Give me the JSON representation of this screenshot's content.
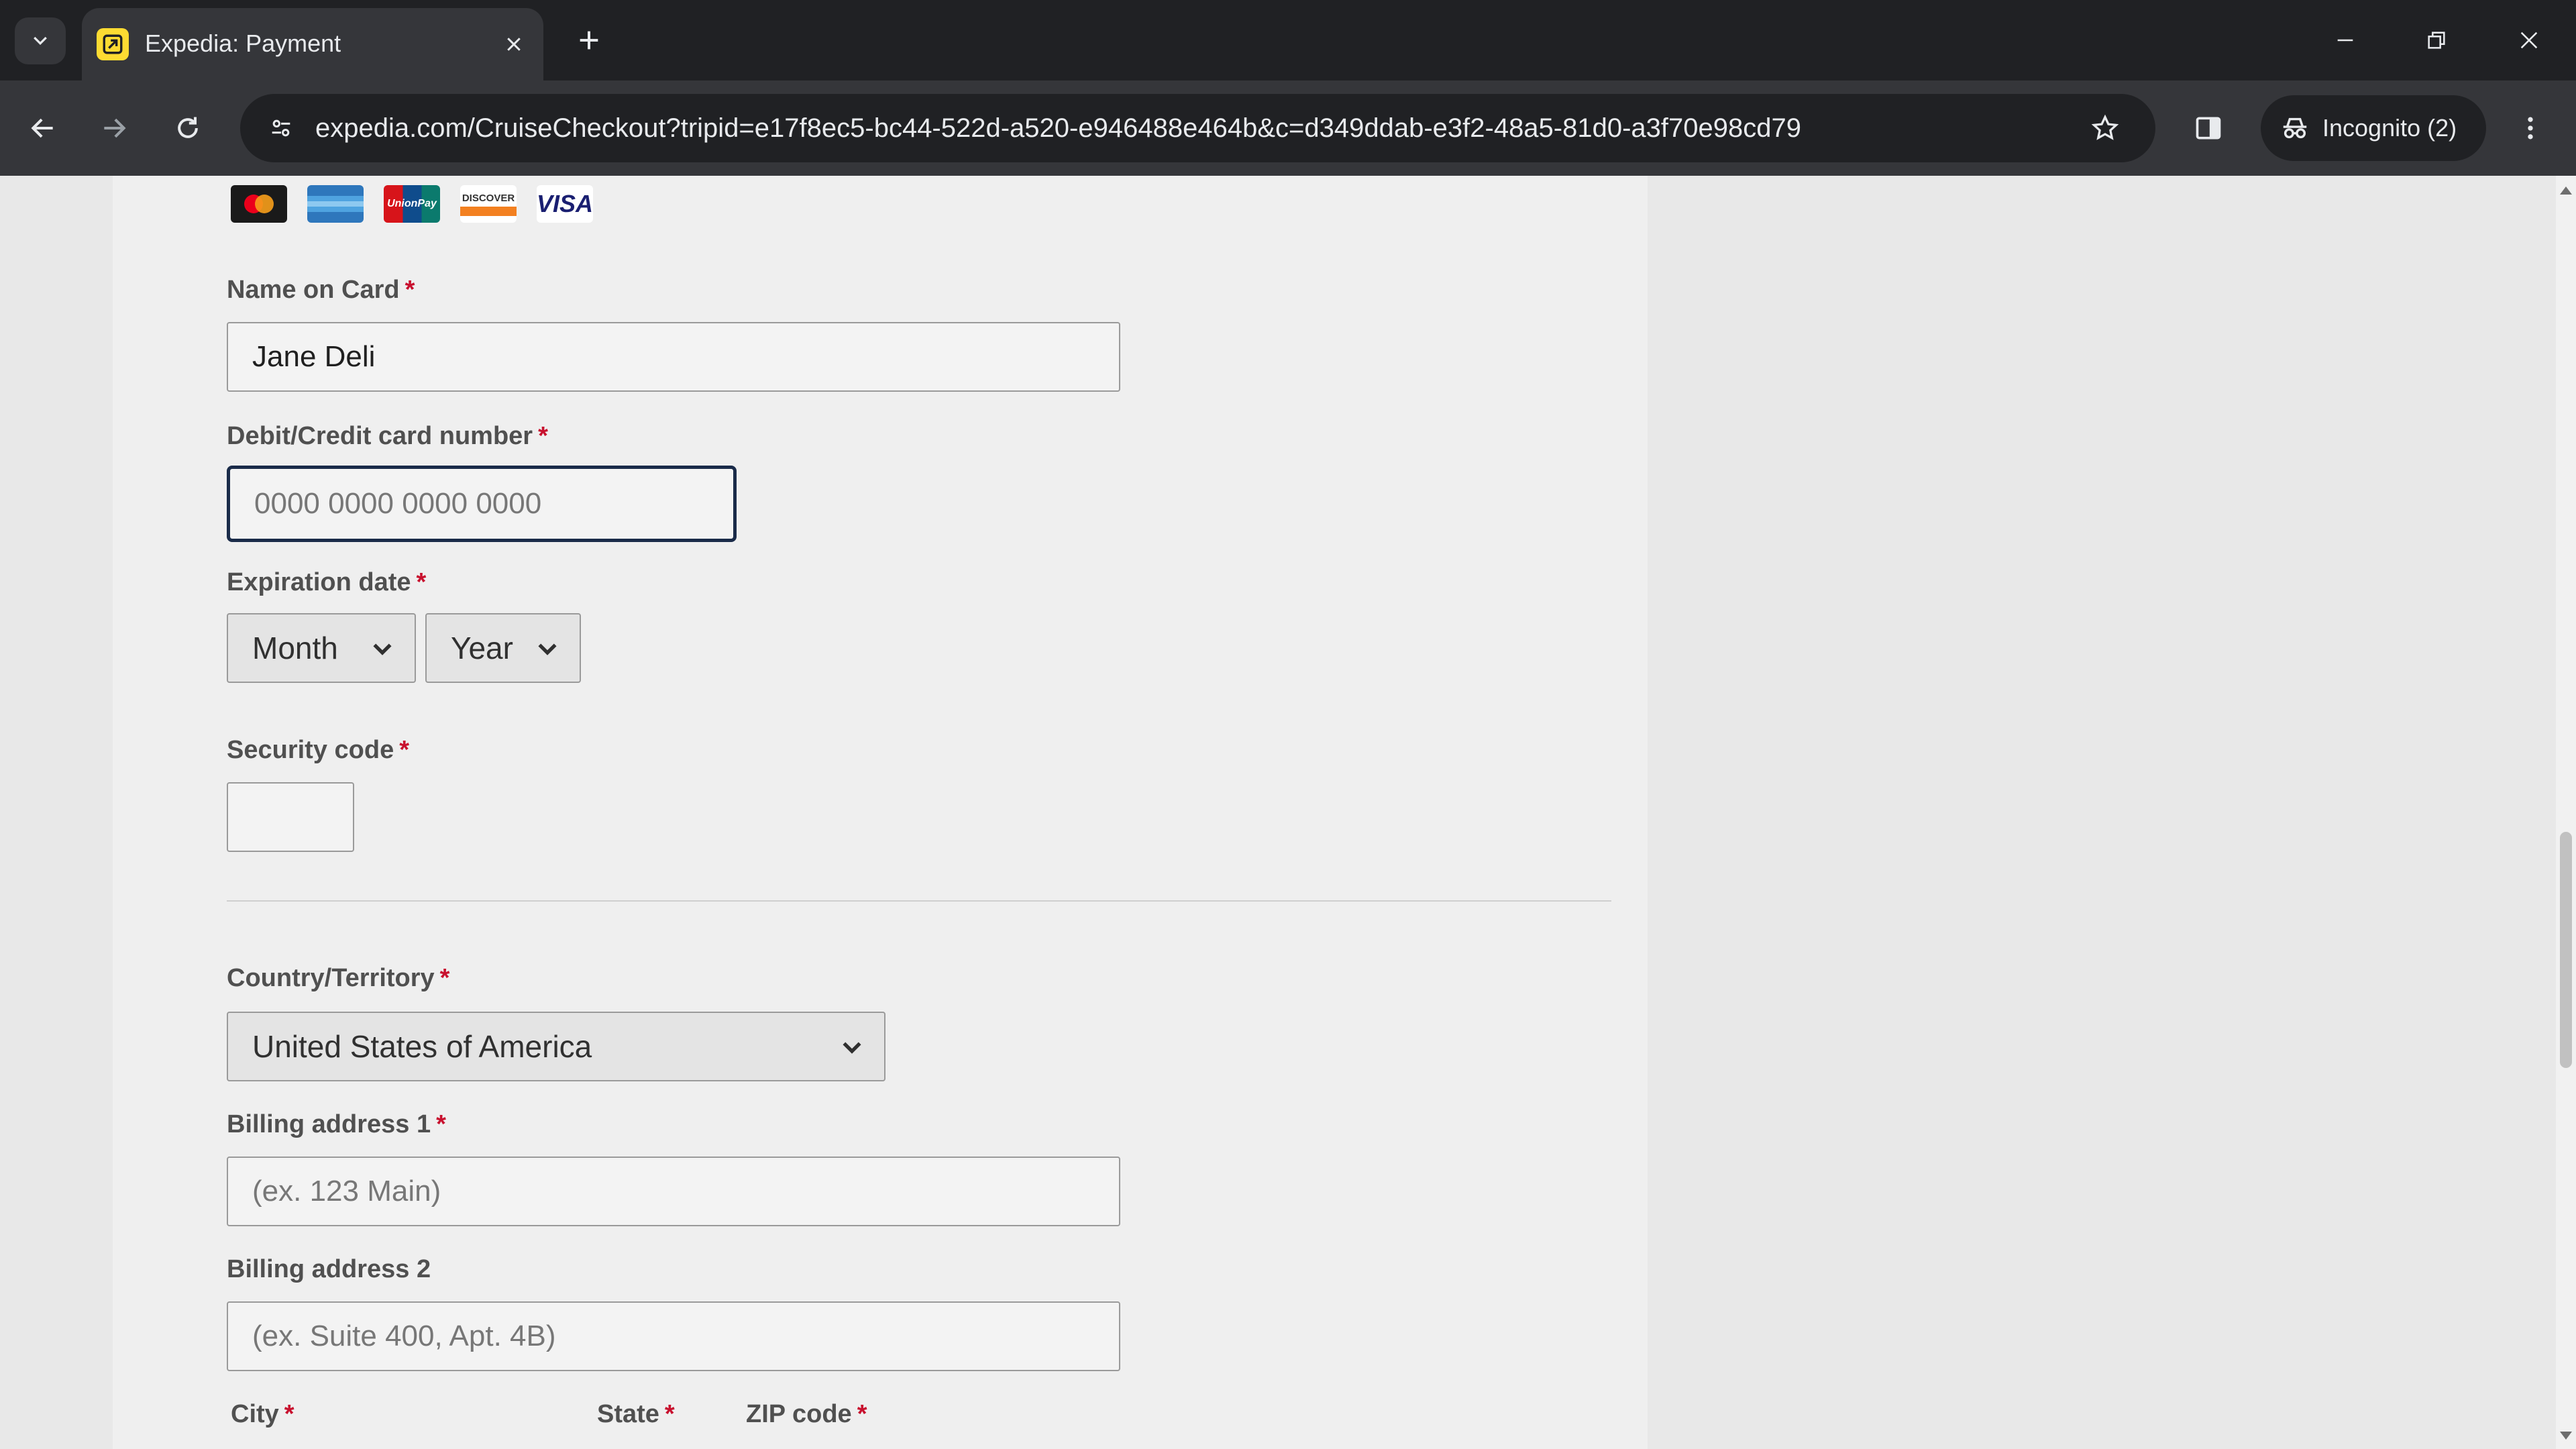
{
  "browser": {
    "tab_title": "Expedia: Payment",
    "url": "expedia.com/CruiseCheckout?tripid=e17f8ec5-bc44-522d-a520-e946488e464b&c=d349ddab-e3f2-48a5-81d0-a3f70e98cd79",
    "incognito_label": "Incognito (2)"
  },
  "payment": {
    "card_logos": [
      "mastercard",
      "amex",
      "unionpay",
      "discover",
      "VISA"
    ],
    "unionpay_text": "UnionPay",
    "discover_text": "DISCOVER",
    "visa_text": "VISA",
    "name_on_card_label": "Name on Card",
    "name_on_card_value": "Jane Deli",
    "card_number_label": "Debit/Credit card number",
    "card_number_placeholder": "0000 0000 0000 0000",
    "expiration_label": "Expiration date",
    "month_label": "Month",
    "year_label": "Year",
    "security_code_label": "Security code",
    "required_mark": "*"
  },
  "billing": {
    "country_label": "Country/Territory",
    "country_value": "United States of America",
    "address1_label": "Billing address 1",
    "address1_placeholder": "(ex. 123 Main)",
    "address2_label": "Billing address 2",
    "address2_placeholder": "(ex. Suite 400, Apt. 4B)",
    "city_label": "City",
    "state_label": "State",
    "zip_label": "ZIP code"
  },
  "colors": {
    "required": "#c8102e",
    "focus_border": "#1a2b49",
    "chrome_dark": "#202124",
    "chrome_mid": "#35363a"
  }
}
